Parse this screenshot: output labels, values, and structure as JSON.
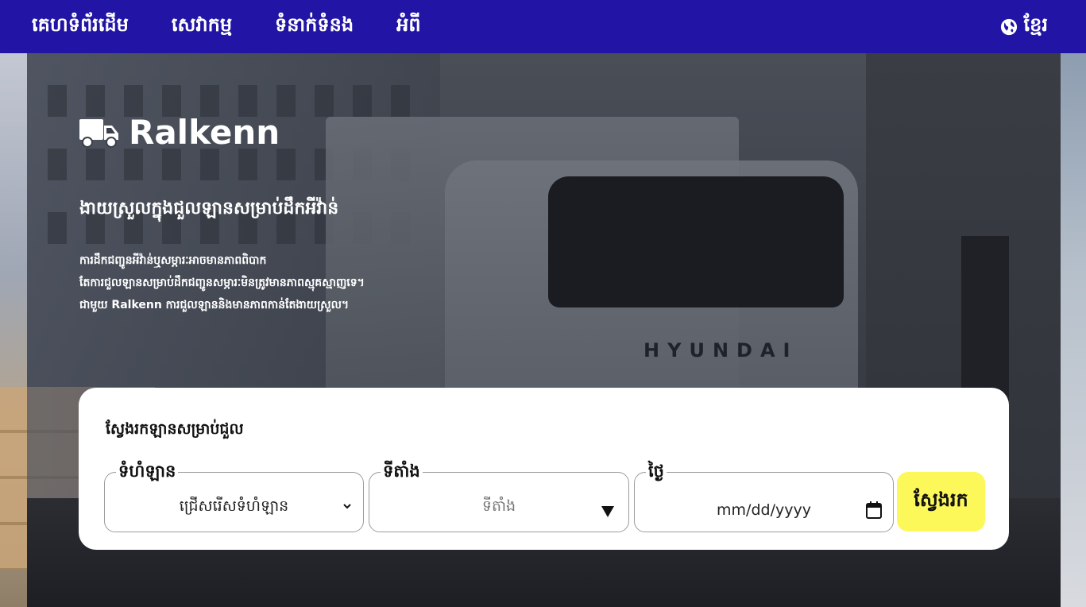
{
  "nav": {
    "items": [
      {
        "label": "គេហទំព័រដើម"
      },
      {
        "label": "សេវាកម្ម"
      },
      {
        "label": "ទំនាក់ទំនង"
      },
      {
        "label": "អំពី"
      }
    ],
    "language": {
      "label": "ខ្មែរ",
      "icon": "globe-icon"
    }
  },
  "hero": {
    "brand": "Ralkenn",
    "brand_icon": "truck-icon",
    "tagline": "ងាយស្រួលក្នុងជួលឡានសម្រាប់ដឹកអីវ៉ាន់",
    "description": [
      "ការដឹកជញ្ជូនអីវ៉ាន់ឬសម្ភារៈអាចមានភាពពិបាក",
      "តែការជួលឡានសម្រាប់ដឹកជញ្ជូនសម្ភារៈមិនត្រូវមានភាពស្មុគស្មាញទេ។",
      "ជាមួយ Ralkenn ការជួលឡាននិងមានភាពកាន់តែងាយស្រួល។"
    ],
    "vehicle_brand_text": "HYUNDAI"
  },
  "search": {
    "title": "ស្វែងរកឡានសម្រាប់ជួល",
    "fields": {
      "size": {
        "label": "ទំហំឡាន",
        "value": "ជ្រើសរើសទំហំឡាន",
        "icon": "chevron-down-icon"
      },
      "location": {
        "label": "ទីតាំង",
        "placeholder": "ទីតាំង",
        "icon": "caret-down-icon"
      },
      "date": {
        "label": "ថ្ងៃ",
        "placeholder": "mm/dd/yyyy",
        "icon": "calendar-icon"
      }
    },
    "button_label": "ស្វែងរក"
  },
  "colors": {
    "nav_bg": "#2215a5",
    "button_bg": "#fdf85a",
    "card_bg": "#ffffff"
  }
}
